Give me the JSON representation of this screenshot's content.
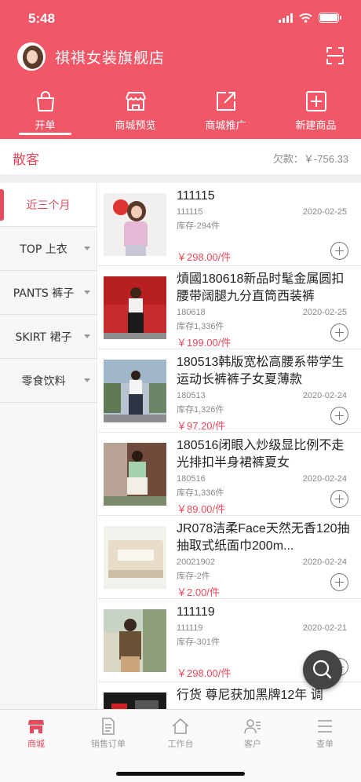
{
  "status_bar": {
    "time": "5:48"
  },
  "header": {
    "shop_name": "祺祺女装旗舰店"
  },
  "tabs": [
    {
      "label": "开单",
      "icon": "bag-icon",
      "active": true
    },
    {
      "label": "商城预览",
      "icon": "store-icon",
      "active": false
    },
    {
      "label": "商城推广",
      "icon": "share-icon",
      "active": false
    },
    {
      "label": "新建商品",
      "icon": "add-square-icon",
      "active": false
    }
  ],
  "customer": {
    "name": "散客",
    "debt_label": "欠款：",
    "debt_value": "￥-756.33"
  },
  "categories": [
    {
      "label": "近三个月",
      "active": true
    },
    {
      "label": "TOP 上衣",
      "active": false
    },
    {
      "label": "PANTS 裤子",
      "active": false
    },
    {
      "label": "SKIRT 裙子",
      "active": false
    },
    {
      "label": "零食饮料",
      "active": false
    }
  ],
  "products": [
    {
      "name": "111115",
      "code": "111115",
      "date": "2020-02-25",
      "stock": "库存-294件",
      "price": "￥298.00/件"
    },
    {
      "name": "熕國180618新品时髦金属圆扣腰带阔腿九分直筒西装裤",
      "code": "180618",
      "date": "2020-02-25",
      "stock": "库存1,336件",
      "price": "￥199.00/件"
    },
    {
      "name": "180513韩版宽松高腰系带学生运动长裤裤子女夏薄款",
      "code": "180513",
      "date": "2020-02-24",
      "stock": "库存1,326件",
      "price": "￥97.20/件"
    },
    {
      "name": "180516闭眼入炒级显比例不走光排扣半身裙裤夏女",
      "code": "180516",
      "date": "2020-02-24",
      "stock": "库存1,336件",
      "price": "￥89.00/件"
    },
    {
      "name": "JR078洁柔Face天然无香120抽抽取式纸面巾200m...",
      "code": "20021902",
      "date": "2020-02-24",
      "stock": "库存-2件",
      "price": "￥2.00/件"
    },
    {
      "name": "111119",
      "code": "111119",
      "date": "2020-02-21",
      "stock": "库存-301件",
      "price": "￥298.00/件"
    },
    {
      "name": "行货 尊尼获加黑牌12年 调",
      "code": "",
      "date": "",
      "stock": "",
      "price": ""
    }
  ],
  "bottom_nav": [
    {
      "label": "商城",
      "icon": "store-icon",
      "active": true
    },
    {
      "label": "销售订单",
      "icon": "document-icon",
      "active": false
    },
    {
      "label": "工作台",
      "icon": "home-icon",
      "active": false
    },
    {
      "label": "客户",
      "icon": "customers-icon",
      "active": false
    },
    {
      "label": "查单",
      "icon": "list-icon",
      "active": false
    }
  ],
  "colors": {
    "brand": "#f25768",
    "accent_text": "#e54b5c"
  }
}
